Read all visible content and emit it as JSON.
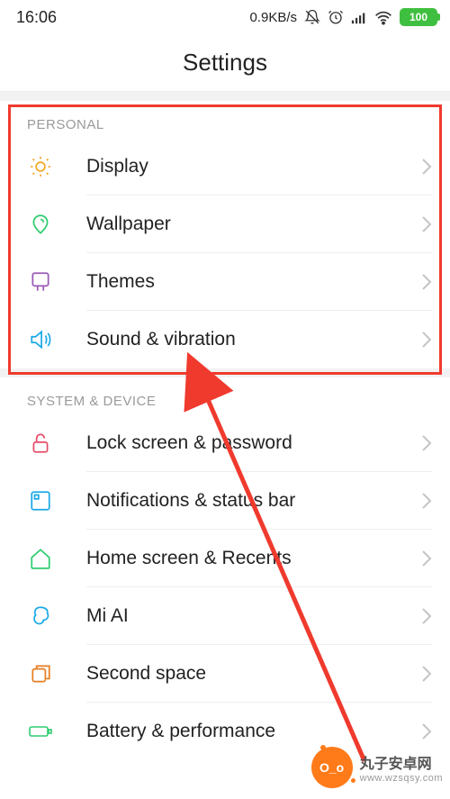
{
  "statusbar": {
    "clock": "16:06",
    "speed": "0.9KB/s",
    "battery_text": "100"
  },
  "title": "Settings",
  "sections": {
    "personal": {
      "header": "PERSONAL",
      "items": {
        "display": "Display",
        "wallpaper": "Wallpaper",
        "themes": "Themes",
        "sound": "Sound & vibration"
      }
    },
    "system": {
      "header": "SYSTEM & DEVICE",
      "items": {
        "lock": "Lock screen & password",
        "notifications": "Notifications & status bar",
        "home": "Home screen & Recents",
        "miai": "Mi AI",
        "second": "Second space",
        "battery": "Battery & performance"
      }
    }
  },
  "watermark": {
    "ball": "O_o",
    "name": "丸子安卓网",
    "url": "www.wzsqsy.com"
  },
  "icon_colors": {
    "display": "#f5a623",
    "wallpaper": "#2ecc71",
    "themes": "#9b59b6",
    "sound": "#1ba9e6",
    "lock": "#e74c6a",
    "notifications": "#1ba9e6",
    "home": "#2ecc71",
    "miai": "#1ba9e6",
    "second": "#e67e22",
    "battery": "#2ecc71"
  }
}
